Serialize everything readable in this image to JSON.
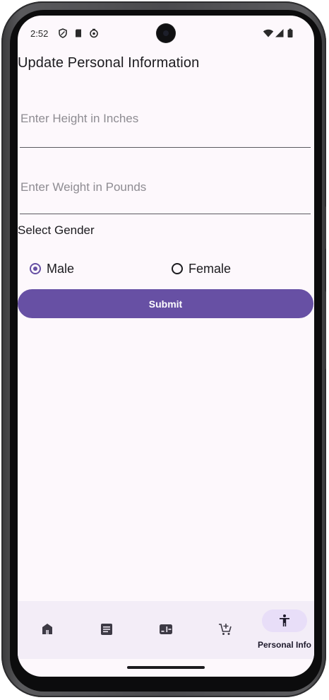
{
  "status_bar": {
    "time": "2:52",
    "icons": [
      "shield-icon",
      "sd-card-icon",
      "sync-icon",
      "wifi-icon",
      "signal-icon",
      "battery-icon"
    ]
  },
  "page": {
    "title": "Update Personal Information"
  },
  "form": {
    "height_field": {
      "placeholder": "Enter Height in Inches",
      "value": ""
    },
    "weight_field": {
      "placeholder": "Enter Weight in Pounds",
      "value": ""
    },
    "gender_label": "Select Gender",
    "gender_options": [
      {
        "label": "Male",
        "selected": true
      },
      {
        "label": "Female",
        "selected": false
      }
    ],
    "submit_label": "Submit"
  },
  "bottom_nav": {
    "items": [
      {
        "icon": "home-icon",
        "label": ""
      },
      {
        "icon": "article-icon",
        "label": ""
      },
      {
        "icon": "dashboard-icon",
        "label": ""
      },
      {
        "icon": "cart-add-icon",
        "label": ""
      },
      {
        "icon": "accessibility-icon",
        "label": "Personal Info",
        "active": true
      }
    ]
  },
  "colors": {
    "accent": "#6750a4",
    "background": "#fdf8fc",
    "nav_background": "#f3edf7",
    "active_pill": "#e8def8"
  }
}
